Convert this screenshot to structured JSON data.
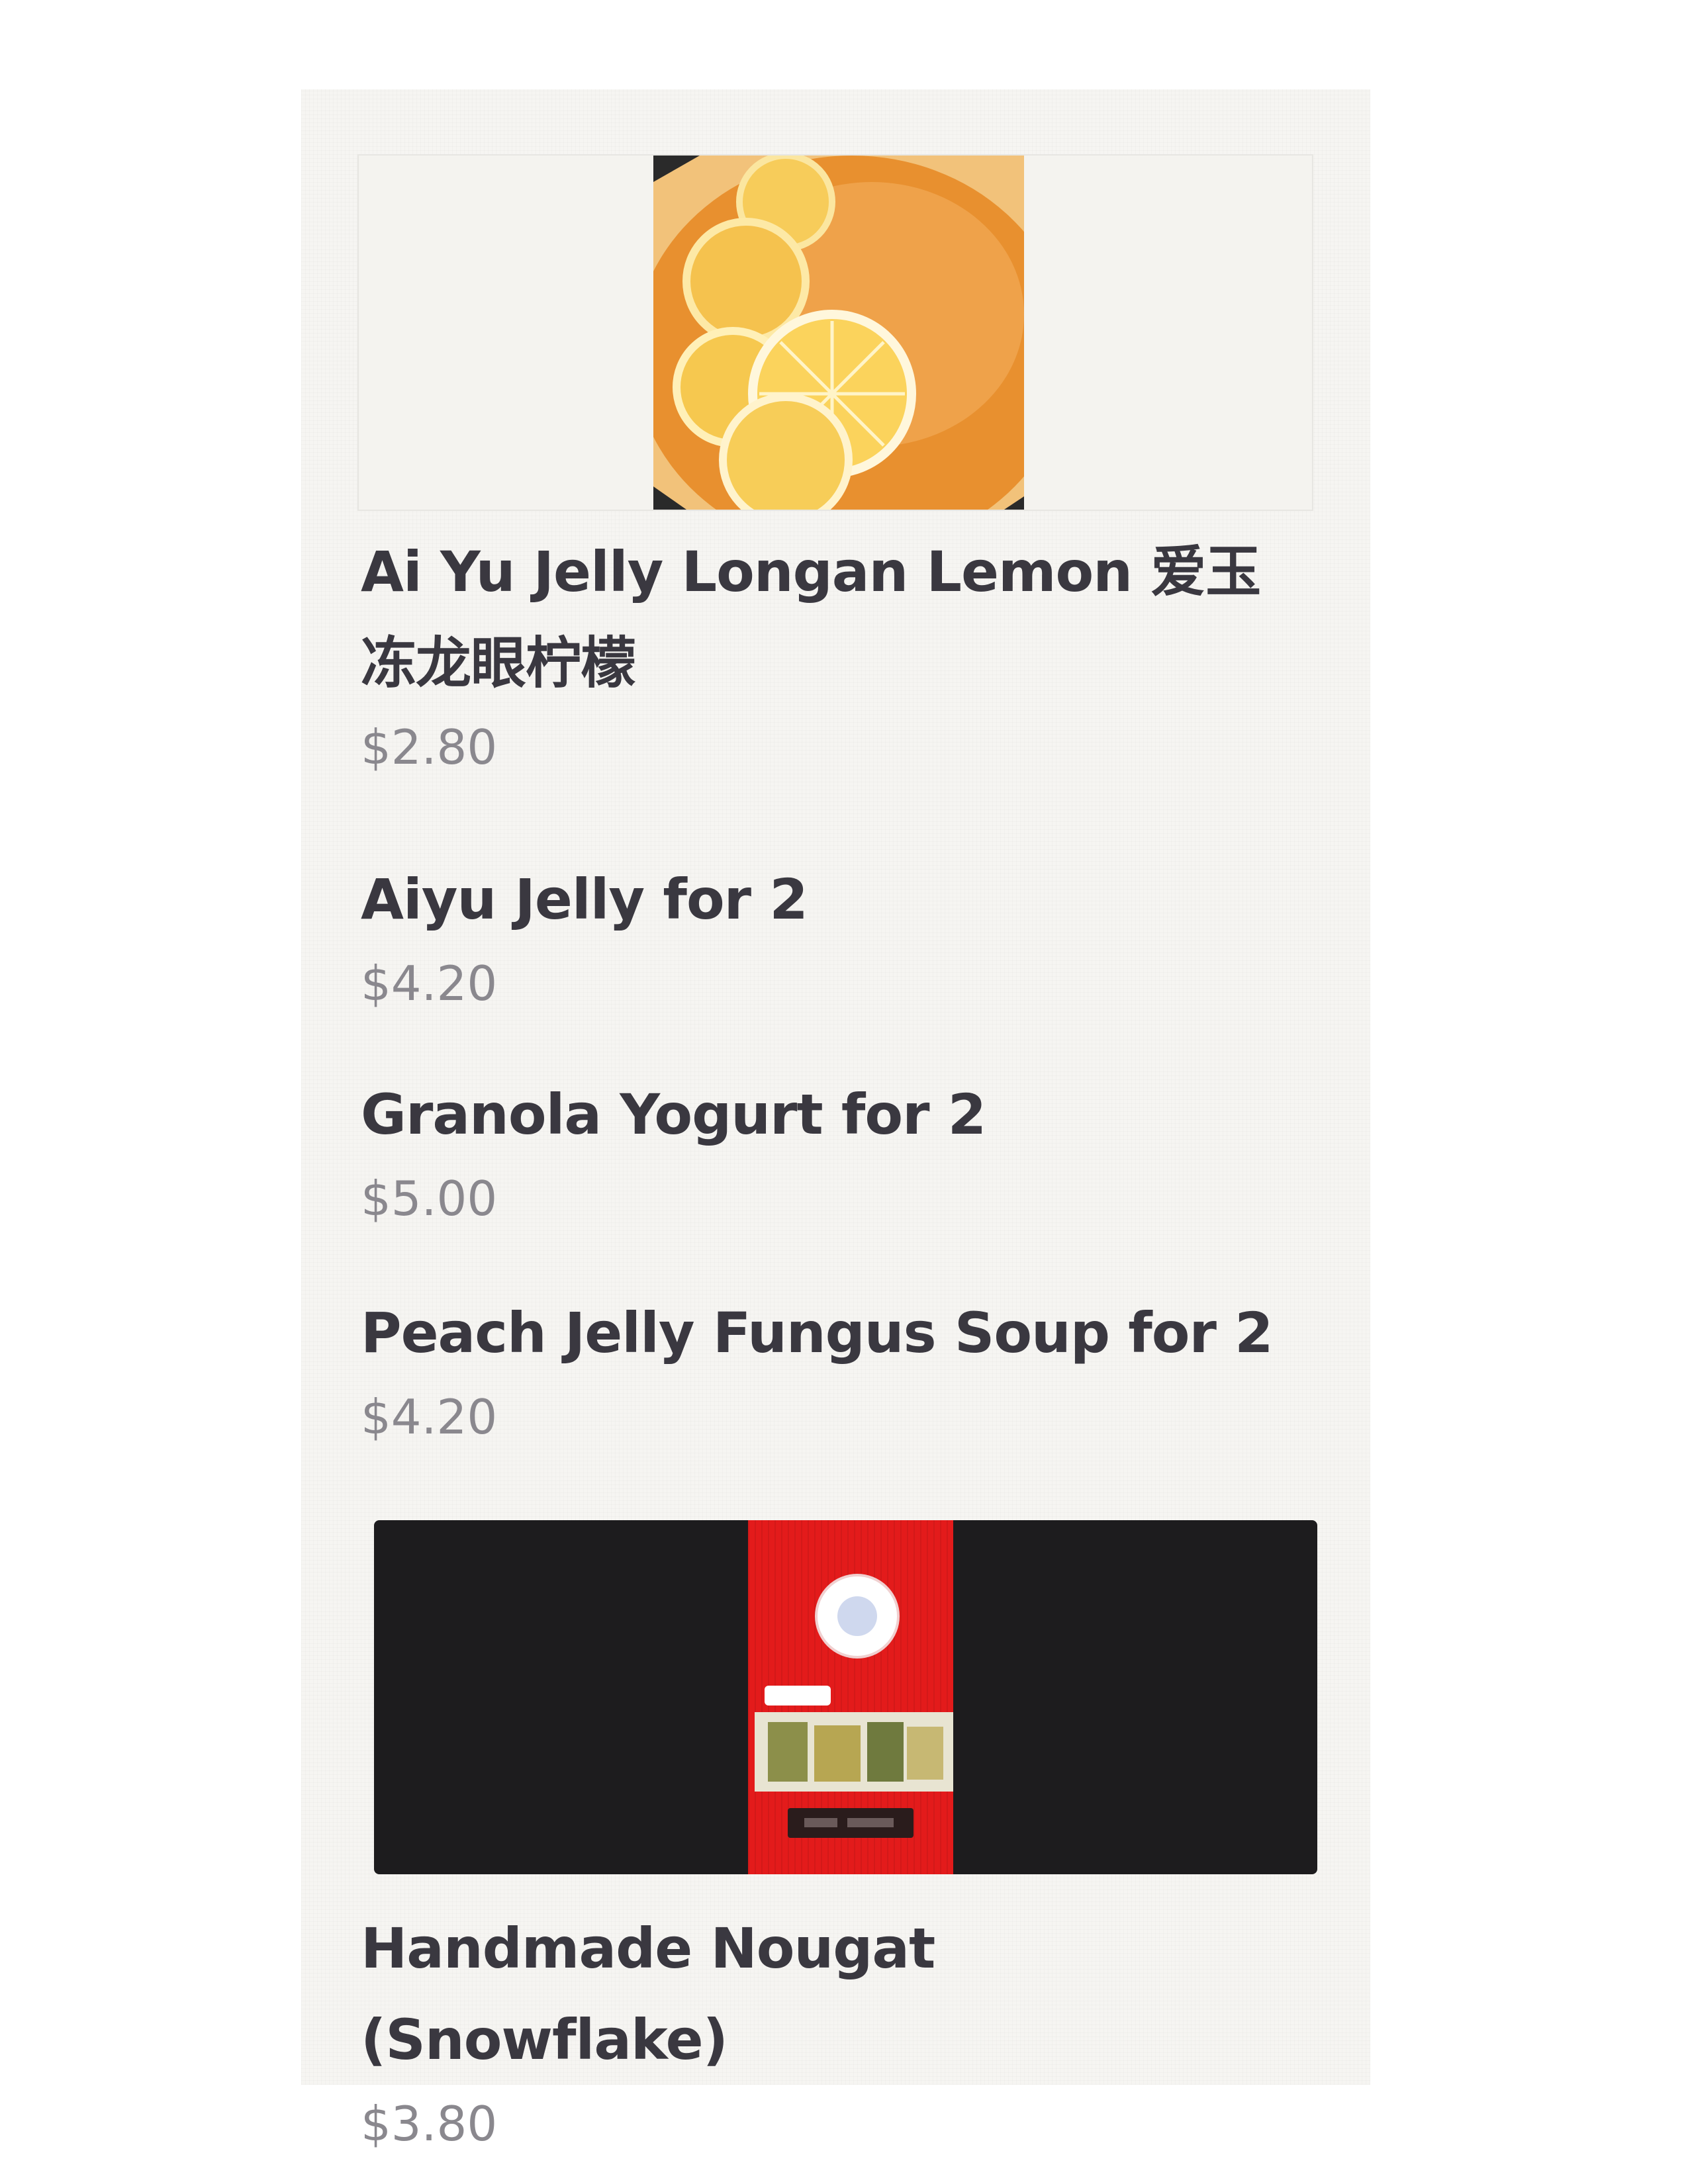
{
  "menu": {
    "items": [
      {
        "name": "Ai Yu Jelly Longan Lemon 爱玉冻龙眼柠檬",
        "price": "$2.80",
        "image": "lemon-jelly-photo"
      },
      {
        "name": "Aiyu Jelly for 2",
        "price": "$4.20"
      },
      {
        "name": "Granola Yogurt for 2",
        "price": "$5.00"
      },
      {
        "name": "Peach Jelly Fungus Soup for 2",
        "price": "$4.20"
      },
      {
        "name": "Handmade Nougat (Snowflake)",
        "price": "$3.80",
        "image": "nougat-package-photo"
      }
    ]
  },
  "colors": {
    "title_text": "#3a3840",
    "price_text": "#8a888e",
    "nougat_package": "#e31b1b",
    "lemon_jelly": "#e9a24a"
  }
}
